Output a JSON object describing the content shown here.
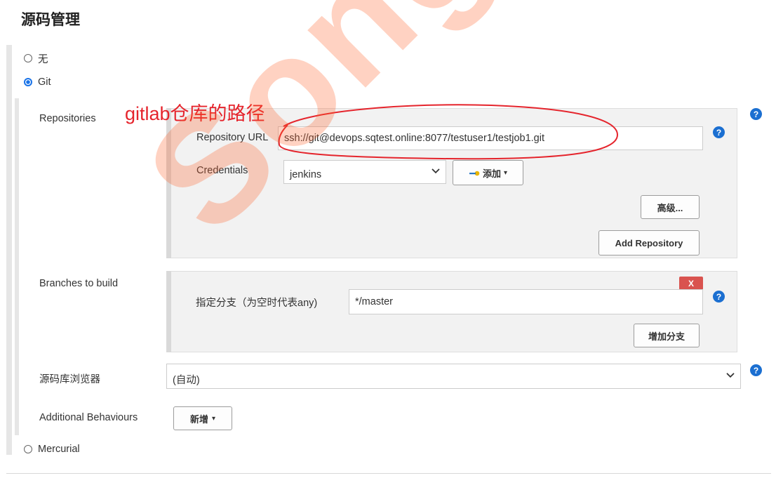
{
  "section_title": "源码管理",
  "scm_options": {
    "none_label": "无",
    "git_label": "Git",
    "mercurial_label": "Mercurial"
  },
  "annotation_text": "gitlab仓库的路径",
  "repositories": {
    "section_label": "Repositories",
    "url_label": "Repository URL",
    "url_value": "ssh://git@devops.sqtest.online:8077/testuser1/testjob1.git",
    "credentials_label": "Credentials",
    "credentials_value": "jenkins",
    "add_credentials_label": "添加",
    "advanced_label": "高级...",
    "add_repository_label": "Add Repository"
  },
  "branches": {
    "section_label": "Branches to build",
    "branch_spec_label": "指定分支（为空时代表any)",
    "branch_spec_value": "*/master",
    "delete_label": "X",
    "add_branch_label": "增加分支"
  },
  "browser": {
    "label": "源码库浏览器",
    "value": "(自动)"
  },
  "behaviours": {
    "label": "Additional Behaviours",
    "add_label": "新增"
  },
  "help_glyph": "?",
  "dropdown_caret": "▾",
  "watermark_text": "Song",
  "colors": {
    "help_blue": "#1b6fd1",
    "radio_blue": "#1a73e8",
    "delete_red": "#d9534f",
    "annotation_red": "#e5242c"
  }
}
